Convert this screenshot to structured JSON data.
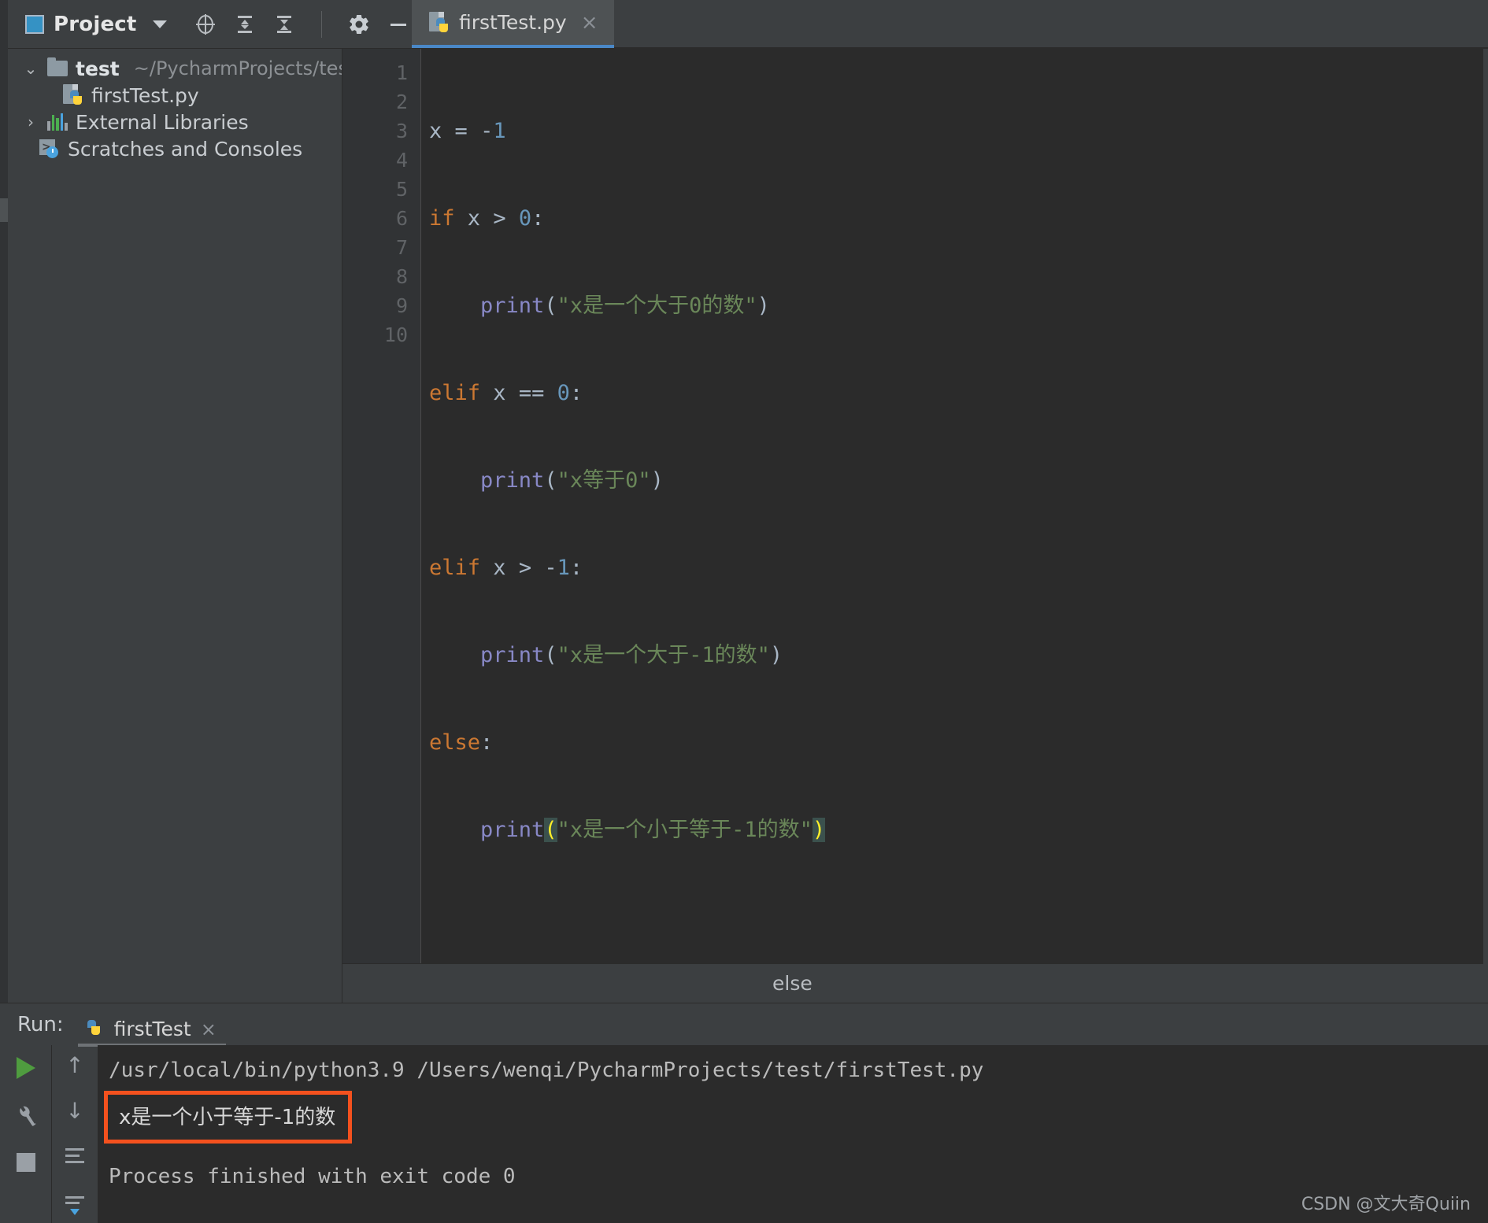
{
  "toolbar": {
    "project_label": "Project",
    "dropdown_icon": "chevron-down-icon",
    "icons": [
      {
        "name": "locate-target-icon",
        "glyph": "⊕"
      },
      {
        "name": "expand-all-icon",
        "glyph": "⇕"
      },
      {
        "name": "collapse-all-icon",
        "glyph": "⇵"
      },
      {
        "name": "settings-gear-icon",
        "glyph": "⚙"
      },
      {
        "name": "hide-panel-icon",
        "glyph": "—"
      }
    ]
  },
  "editor_tab": {
    "filename": "firstTest.py",
    "close_label": "×",
    "icon": "python-file-icon"
  },
  "project_tree": [
    {
      "indent": 0,
      "arrow": "⌄",
      "icon": "folder-icon",
      "name": "test",
      "path": "~/PycharmProjects/test",
      "bold": true
    },
    {
      "indent": 1,
      "arrow": "",
      "icon": "python-file-icon",
      "name": "firstTest.py",
      "path": "",
      "bold": false
    },
    {
      "indent": 0,
      "arrow": "›",
      "icon": "external-libraries-icon",
      "name": "External Libraries",
      "path": "",
      "bold": false
    },
    {
      "indent": 0,
      "arrow": "",
      "icon": "scratches-icon",
      "name": "Scratches and Consoles",
      "path": "",
      "bold": false
    }
  ],
  "code": {
    "line_numbers": [
      "1",
      "2",
      "3",
      "4",
      "5",
      "6",
      "7",
      "8",
      "9",
      "10"
    ],
    "lines": [
      "x = -1",
      "if x > 0:",
      "    print(\"x是一个大于0的数\")",
      "elif x == 0:",
      "    print(\"x等于0\")",
      "elif x > -1:",
      "    print(\"x是一个大于-1的数\")",
      "else:",
      "    print(\"x是一个小于等于-1的数\")",
      ""
    ]
  },
  "breadcrumb": {
    "text": "else"
  },
  "run_panel": {
    "title": "Run:",
    "tab_name": "firstTest",
    "tab_close": "×",
    "tab_icon": "python-icon",
    "tools": [
      {
        "name": "run-button",
        "glyph": "▶"
      },
      {
        "name": "wrench-settings-icon",
        "glyph": "🔧"
      },
      {
        "name": "stop-button",
        "glyph": "■"
      }
    ],
    "nav_tools": [
      {
        "name": "scroll-up-icon",
        "glyph": "↑"
      },
      {
        "name": "scroll-down-icon",
        "glyph": "↓"
      },
      {
        "name": "soft-wrap-icon",
        "glyph": "≡"
      },
      {
        "name": "scroll-to-end-icon",
        "glyph": "⤓"
      }
    ],
    "command_line": "/usr/local/bin/python3.9 /Users/wenqi/PycharmProjects/test/firstTest.py",
    "program_output": "x是一个小于等于-1的数",
    "exit_line": "Process finished with exit code 0",
    "highlight_color": "#f4511e"
  },
  "watermark": "CSDN @文大奇Quiin",
  "colors": {
    "background": "#3c3f41",
    "editor_background": "#2b2b2b",
    "gutter": "#313335",
    "keyword": "#cc7832",
    "string": "#6a8759",
    "number": "#6897bb",
    "function": "#8888c6",
    "text": "#a9b7c6",
    "tab_active_underline": "#4a88c7",
    "bracket_highlight": "#ffef28"
  }
}
